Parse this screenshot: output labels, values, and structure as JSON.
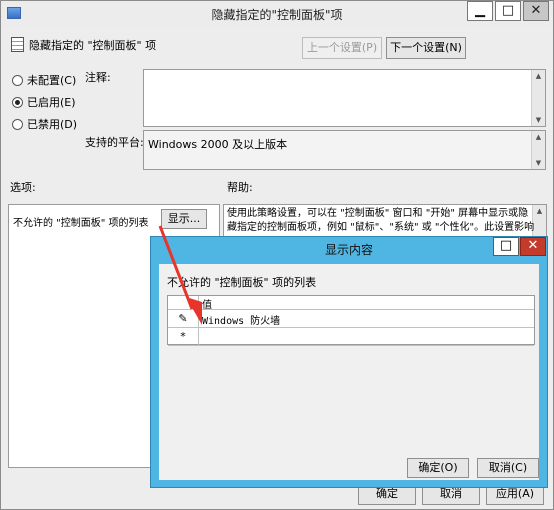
{
  "window": {
    "title": "隐藏指定的\"控制面板\"项",
    "minimize": "▁",
    "maximize": "□",
    "close": "✕"
  },
  "policy": {
    "name": "隐藏指定的 \"控制面板\" 项",
    "prev_button": "上一个设置(P)",
    "next_button": "下一个设置(N)"
  },
  "state": {
    "not_configured": "未配置(C)",
    "enabled": "已启用(E)",
    "disabled": "已禁用(D)",
    "selected": "enabled"
  },
  "comment": {
    "label": "注释:",
    "value": ""
  },
  "platform": {
    "label": "支持的平台:",
    "value": "Windows 2000 及以上版本"
  },
  "options": {
    "label": "选项:",
    "list_label": "不允许的 \"控制面板\" 项的列表",
    "show_button": "显示..."
  },
  "help": {
    "label": "帮助:",
    "text": "使用此策略设置，可以在 \"控制面板\" 窗口和 \"开始\" 屏幕中显示或隐藏指定的控制面板项，例如 \"鼠标\"、\"系统\" 或 \"个性化\"。此设置影响"
  },
  "footer": {
    "ok": "确定",
    "cancel": "取消",
    "apply": "应用(A)"
  },
  "dialog": {
    "title": "显示内容",
    "maximize": "□",
    "close": "✕",
    "list_label": "不允许的 \"控制面板\" 项的列表",
    "column_header": "值",
    "rows": [
      {
        "mark": "✎",
        "value": "Windows 防火墙"
      },
      {
        "mark": "*",
        "value": ""
      }
    ],
    "ok": "确定(O)",
    "cancel": "取消(C)"
  },
  "colors": {
    "dialog_frame": "#4fb6e4",
    "close_red": "#c43b2c",
    "annotation_arrow": "#e8352b"
  }
}
